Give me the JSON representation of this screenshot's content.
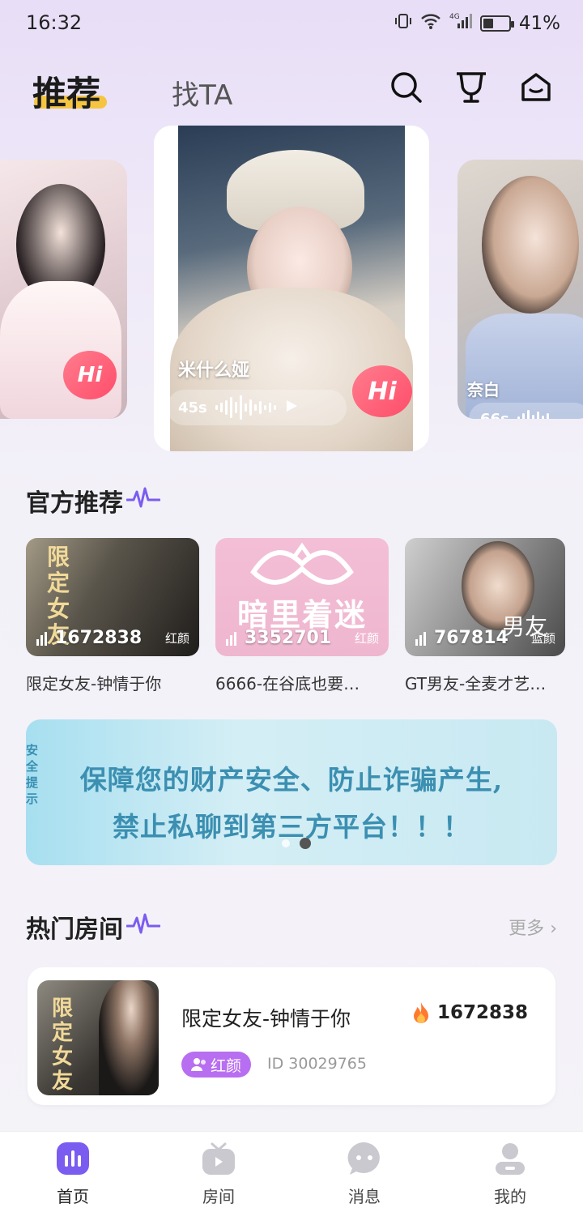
{
  "status_bar": {
    "time": "16:32",
    "network": "4G",
    "battery": "41%",
    "battery_level": 0.41
  },
  "header": {
    "tab_active": "推荐",
    "tab_inactive": "找TA"
  },
  "carousel": {
    "left_card": {
      "hi": "Hi"
    },
    "center_card": {
      "name": "米什么娅",
      "duration": "45s",
      "hi": "Hi"
    },
    "right_card": {
      "name": "奈白",
      "duration": "66s"
    }
  },
  "official": {
    "title": "官方推荐",
    "items": [
      {
        "count": "1672838",
        "tag": "红颜",
        "title": "限定女友-钟情于你",
        "poster_text": "限定女友"
      },
      {
        "count": "3352701",
        "tag": "红颜",
        "title": "6666-在谷底也要…",
        "poster_text": "暗里着迷"
      },
      {
        "count": "767814",
        "tag": "蓝颜",
        "title": "GT男友-全麦才艺…",
        "poster_text": "男友"
      }
    ]
  },
  "banner": {
    "line1": "保障您的财产安全、防止诈骗产生,",
    "line2": "禁止私聊到第三方平台！！！",
    "side": "安全提示"
  },
  "hot_rooms": {
    "title": "热门房间",
    "more": "更多",
    "rooms": [
      {
        "title": "限定女友-钟情于你",
        "hot": "1672838",
        "tag": "红颜",
        "id": "ID 30029765",
        "poster_text": "限定女友"
      }
    ]
  },
  "nav": {
    "home": "首页",
    "rooms": "房间",
    "messages": "消息",
    "mine": "我的"
  },
  "colors": {
    "accent": "#7b5cf0",
    "hi": "#ff4d6a",
    "tab_underline": "#f5c542",
    "room_tag": "#b86ef0"
  }
}
